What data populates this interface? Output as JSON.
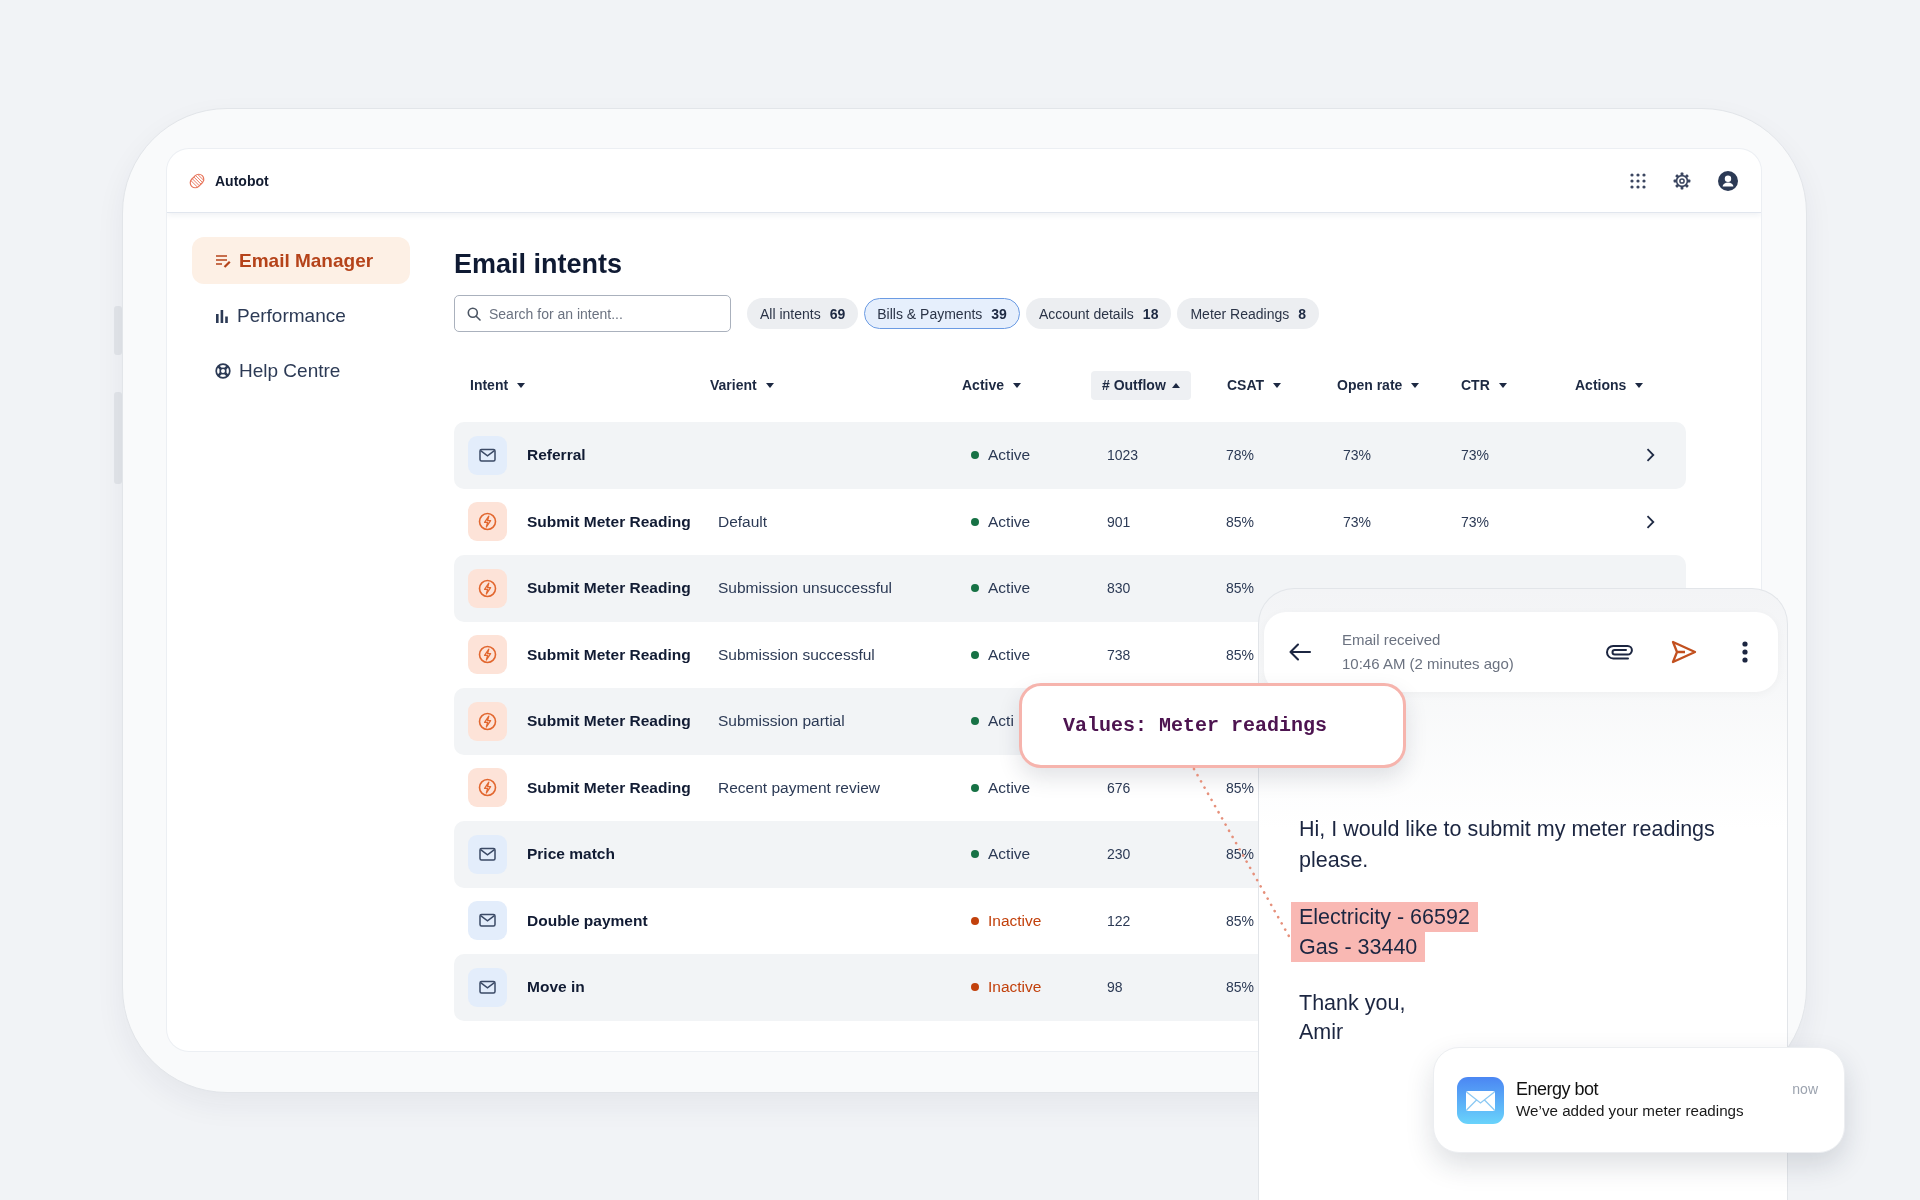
{
  "header": {
    "app_name": "Autobot"
  },
  "sidebar": {
    "items": [
      {
        "label": "Email Manager",
        "selected": true
      },
      {
        "label": "Performance",
        "selected": false
      },
      {
        "label": "Help Centre",
        "selected": false
      }
    ]
  },
  "main": {
    "title": "Email intents",
    "search": {
      "placeholder": "Search for an intent..."
    },
    "filters": [
      {
        "label": "All intents",
        "count": "69",
        "selected": false
      },
      {
        "label": "Bills & Payments",
        "count": "39",
        "selected": true
      },
      {
        "label": "Account details",
        "count": "18",
        "selected": false
      },
      {
        "label": "Meter Readings",
        "count": "8",
        "selected": false
      }
    ],
    "columns": [
      {
        "label": "Intent",
        "selected": false
      },
      {
        "label": "Varient",
        "selected": false
      },
      {
        "label": "Active",
        "selected": false
      },
      {
        "label": "# Outflow",
        "selected": true
      },
      {
        "label": "CSAT",
        "selected": false
      },
      {
        "label": "Open rate",
        "selected": false
      },
      {
        "label": "CTR",
        "selected": false
      },
      {
        "label": "Actions",
        "selected": false
      }
    ],
    "rows": [
      {
        "kind": "email",
        "intent": "Referral",
        "status": "Active",
        "active": true,
        "outflow": "1023",
        "csat": "78%",
        "open_rate": "73%",
        "ctr": "73%",
        "chevron": true
      },
      {
        "kind": "meter",
        "intent": "Submit Meter Reading",
        "variant": "Default",
        "status": "Active",
        "active": true,
        "outflow": "901",
        "csat": "85%",
        "open_rate": "73%",
        "ctr": "73%",
        "chevron": true
      },
      {
        "kind": "meter",
        "intent": "Submit Meter Reading",
        "variant": "Submission unsuccessful",
        "status": "Active",
        "active": true,
        "outflow": "830",
        "csat": "85%"
      },
      {
        "kind": "meter",
        "intent": "Submit Meter Reading",
        "variant": "Submission successful",
        "status": "Active",
        "active": true,
        "outflow": "738",
        "csat": "85%"
      },
      {
        "kind": "meter",
        "intent": "Submit Meter Reading",
        "variant": "Submission partial",
        "status": "Acti",
        "active": true
      },
      {
        "kind": "meter",
        "intent": "Submit Meter Reading",
        "variant": "Recent payment review",
        "status": "Active",
        "active": true,
        "outflow": "676",
        "csat": "85%"
      },
      {
        "kind": "email",
        "intent": "Price match",
        "status": "Active",
        "active": true,
        "outflow": "230",
        "csat": "85%"
      },
      {
        "kind": "email",
        "intent": "Double payment",
        "status": "Inactive",
        "active": false,
        "outflow": "122",
        "csat": "85%"
      },
      {
        "kind": "email",
        "intent": "Move in",
        "status": "Inactive",
        "active": false,
        "outflow": "98",
        "csat": "85%"
      }
    ]
  },
  "email_panel": {
    "title": "Email received",
    "time": "10:46 AM (2 minutes ago)",
    "message": "Hi, I would like to submit my meter readings please.",
    "highlights": [
      "Electricity - 66592",
      "Gas - 33440"
    ],
    "closing": "Thank you,",
    "signature": "Amir"
  },
  "tooltip": {
    "text": "Values: Meter readings"
  },
  "notification": {
    "title": "Energy bot",
    "message": "We’ve added your meter readings",
    "time": "now"
  }
}
